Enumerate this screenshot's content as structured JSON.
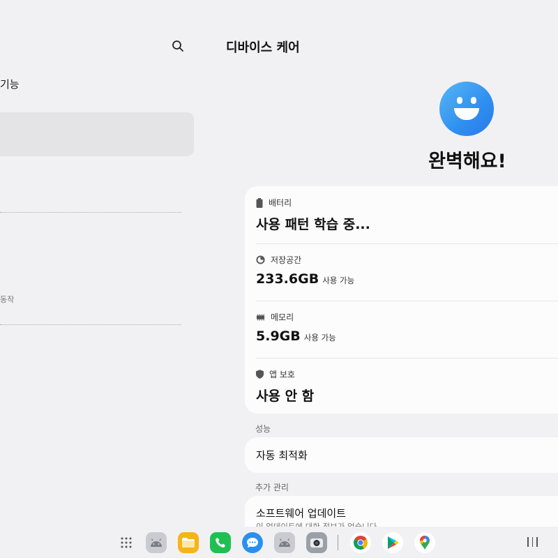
{
  "left_pane": {
    "top_label": "기능",
    "sub_label": "동작"
  },
  "header": {
    "title": "디바이스 케어",
    "search_icon": "search-icon"
  },
  "status": {
    "face_icon": "smiley-face-icon",
    "text": "완벽해요!"
  },
  "care_items": [
    {
      "icon": "battery-icon",
      "label": "배터리",
      "value": "사용 패턴 학습 중...",
      "unit": ""
    },
    {
      "icon": "storage-pie-icon",
      "label": "저장공간",
      "value": "233.6GB",
      "unit": "사용 가능"
    },
    {
      "icon": "memory-chip-icon",
      "label": "메모리",
      "value": "5.9GB",
      "unit": "사용 가능"
    },
    {
      "icon": "shield-icon",
      "label": "앱 보호",
      "value": "사용 안 함",
      "unit": ""
    }
  ],
  "performance": {
    "section_label": "성능",
    "item": "자동 최적화"
  },
  "extra": {
    "section_label": "추가 관리",
    "item": "소프트웨어 업데이트",
    "subtext": "이 업데이트에 대한 정보가 없습니다"
  },
  "taskbar": {
    "apps": [
      "app-drawer-icon",
      "android-app-icon",
      "files-icon",
      "phone-icon",
      "messages-icon",
      "android-app-icon",
      "camera-icon",
      "chrome-icon",
      "play-store-icon",
      "maps-icon"
    ],
    "recents_icon": "recents-icon"
  },
  "colors": {
    "accent_blue": "#2f8ff0",
    "background": "#f1f1f3",
    "card": "#fcfcfd"
  }
}
